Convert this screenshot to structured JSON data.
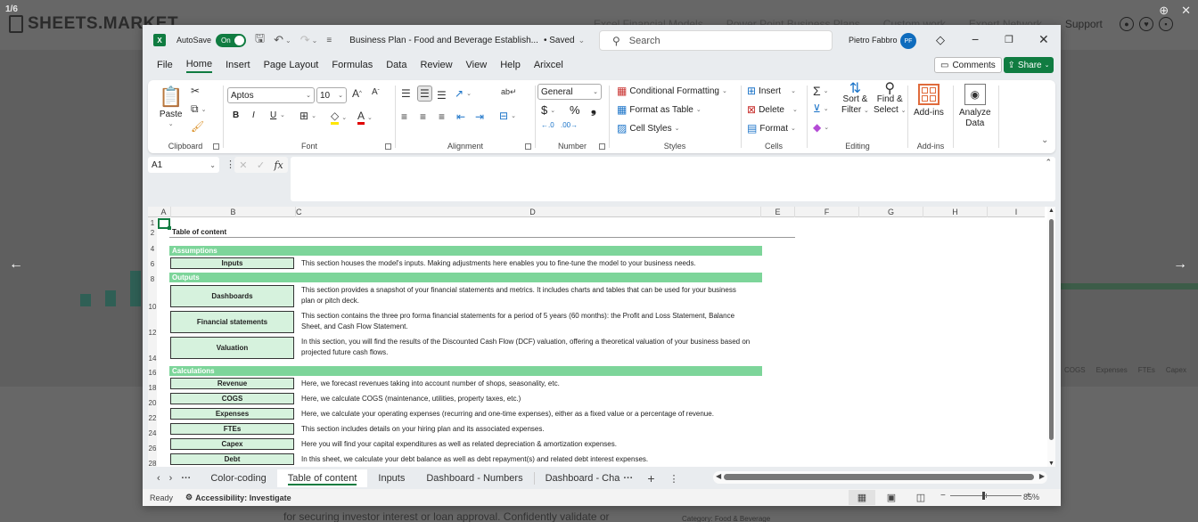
{
  "website": {
    "slide_counter": "1/6",
    "logo": "SHEETS.MARKET",
    "nav": [
      "Excel Financial Models",
      "Power Point Business Plans",
      "Custom work",
      "Expert Network",
      "Support"
    ],
    "bottom_text": "for securing investor interest or loan approval. Confidently validate or",
    "category_text": "Category: Food & Beverage"
  },
  "titlebar": {
    "autosave_label": "AutoSave",
    "autosave_state": "On",
    "doc_title": "Business Plan - Food and Beverage Establish...",
    "saved": "• Saved",
    "search_placeholder": "Search",
    "user_name": "Pietro Fabbro",
    "user_initials": "PF"
  },
  "menu": {
    "items": [
      "File",
      "Home",
      "Insert",
      "Page Layout",
      "Formulas",
      "Data",
      "Review",
      "View",
      "Help",
      "Arixcel"
    ],
    "active": "Home",
    "comments": "Comments",
    "share": "Share"
  },
  "ribbon": {
    "clipboard": {
      "label": "Clipboard",
      "paste": "Paste"
    },
    "font": {
      "label": "Font",
      "name": "Aptos",
      "size": "10",
      "bold": "B",
      "italic": "I",
      "underline": "U"
    },
    "alignment": {
      "label": "Alignment"
    },
    "number": {
      "label": "Number",
      "format": "General",
      "currency": "$",
      "percent": "%",
      "comma": "❟"
    },
    "styles": {
      "label": "Styles",
      "conditional": "Conditional Formatting",
      "format_table": "Format as Table",
      "cell_styles": "Cell Styles"
    },
    "cells": {
      "label": "Cells",
      "insert": "Insert",
      "delete": "Delete",
      "format": "Format"
    },
    "editing": {
      "label": "Editing",
      "sort1": "Sort &",
      "sort2": "Filter",
      "find1": "Find &",
      "find2": "Select"
    },
    "addins": {
      "label": "Add-ins",
      "button": "Add-ins"
    },
    "analyze": {
      "line1": "Analyze",
      "line2": "Data"
    }
  },
  "formula_bar": {
    "name_box": "A1",
    "fx": "fx",
    "content": ""
  },
  "grid": {
    "columns": [
      "A",
      "B",
      "C",
      "D",
      "E",
      "F",
      "G",
      "H",
      "I"
    ],
    "rows": [
      "1",
      "2",
      "4",
      "6",
      "8",
      "10",
      "12",
      "14",
      "16",
      "18",
      "20",
      "22",
      "24",
      "26",
      "28"
    ],
    "toc_title": "Table of content",
    "sections": [
      {
        "title": "Assumptions"
      },
      {
        "title": "Outputs"
      },
      {
        "title": "Calculations"
      }
    ],
    "items": [
      {
        "name": "Inputs",
        "desc": "This section houses the model's inputs. Making adjustments here enables you to fine-tune the model to your business needs."
      },
      {
        "name": "Dashboards",
        "desc": "This section provides a snapshot of your financial statements and metrics. It includes charts and tables that can be used for your business plan or pitch deck."
      },
      {
        "name": "Financial statements",
        "desc": "This section contains the three pro forma financial statements for a period of 5 years (60 months): the Profit and Loss Statement, Balance Sheet, and Cash Flow Statement."
      },
      {
        "name": "Valuation",
        "desc": "In this section, you will find the results of the Discounted Cash Flow (DCF) valuation, offering a theoretical valuation of your business based on projected future cash flows."
      },
      {
        "name": "Revenue",
        "desc": "Here, we forecast revenues taking into account number of shops, seasonality, etc."
      },
      {
        "name": "COGS",
        "desc": "Here, we calculate COGS (maintenance, utilities, property taxes, etc.)"
      },
      {
        "name": "Expenses",
        "desc": "Here, we calculate your operating expenses (recurring and one-time expenses), either as a fixed value or a percentage of revenue."
      },
      {
        "name": "FTEs",
        "desc": "This section includes details on your hiring plan and its associated expenses."
      },
      {
        "name": "Capex",
        "desc": "Here you will find your capital expenditures as well as related depreciation & amortization expenses."
      },
      {
        "name": "Debt",
        "desc": "In this sheet, we calculate your debt balance as well as debt repayment(s) and related debt interest expenses."
      }
    ]
  },
  "sheet_tabs": {
    "tabs": [
      "Color-coding",
      "Table of content",
      "Inputs",
      "Dashboard - Numbers",
      "Dashboard - Cha"
    ],
    "active": "Table of content"
  },
  "status": {
    "ready": "Ready",
    "accessibility": "Accessibility: Investigate",
    "zoom": "85%",
    "zoom_fraction": 0.5
  },
  "accent_color": "#107c41",
  "section_color": "#7dd59a",
  "item_color": "#d6f2dd"
}
